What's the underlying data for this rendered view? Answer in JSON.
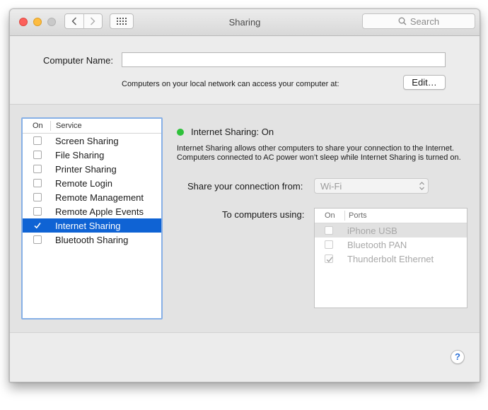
{
  "window": {
    "title": "Sharing",
    "search_placeholder": "Search"
  },
  "toolbar": {
    "back_icon": "chevron-left-icon",
    "forward_icon": "chevron-right-icon",
    "grid_icon": "grid-icon"
  },
  "computer_name": {
    "label": "Computer Name:",
    "value": "",
    "subtext": "Computers on your local network can access your computer at:",
    "edit_label": "Edit…"
  },
  "services": {
    "header_on": "On",
    "header_service": "Service",
    "items": [
      {
        "label": "Screen Sharing",
        "checked": false,
        "selected": false
      },
      {
        "label": "File Sharing",
        "checked": false,
        "selected": false
      },
      {
        "label": "Printer Sharing",
        "checked": false,
        "selected": false
      },
      {
        "label": "Remote Login",
        "checked": false,
        "selected": false
      },
      {
        "label": "Remote Management",
        "checked": false,
        "selected": false
      },
      {
        "label": "Remote Apple Events",
        "checked": false,
        "selected": false
      },
      {
        "label": "Internet Sharing",
        "checked": true,
        "selected": true
      },
      {
        "label": "Bluetooth Sharing",
        "checked": false,
        "selected": false
      }
    ]
  },
  "detail": {
    "status_color": "#2fc13b",
    "status_text": "Internet Sharing: On",
    "description": "Internet Sharing allows other computers to share your connection to the Internet. Computers connected to AC power won’t sleep while Internet Sharing is turned on.",
    "share_from_label": "Share your connection from:",
    "share_from_value": "Wi-Fi",
    "to_computers_label": "To computers using:",
    "ports_header_on": "On",
    "ports_header_ports": "Ports",
    "ports": [
      {
        "label": "iPhone USB",
        "checked": false
      },
      {
        "label": "Bluetooth PAN",
        "checked": false
      },
      {
        "label": "Thunderbolt Ethernet",
        "checked": true
      }
    ]
  },
  "help": {
    "label": "?"
  },
  "colors": {
    "selection": "#0f63d4",
    "focus_ring": "#87b0e6",
    "close": "#fc605b",
    "minimize": "#fdbc40",
    "zoom": "#c9c9c9",
    "help_text": "#2a6fd6"
  }
}
